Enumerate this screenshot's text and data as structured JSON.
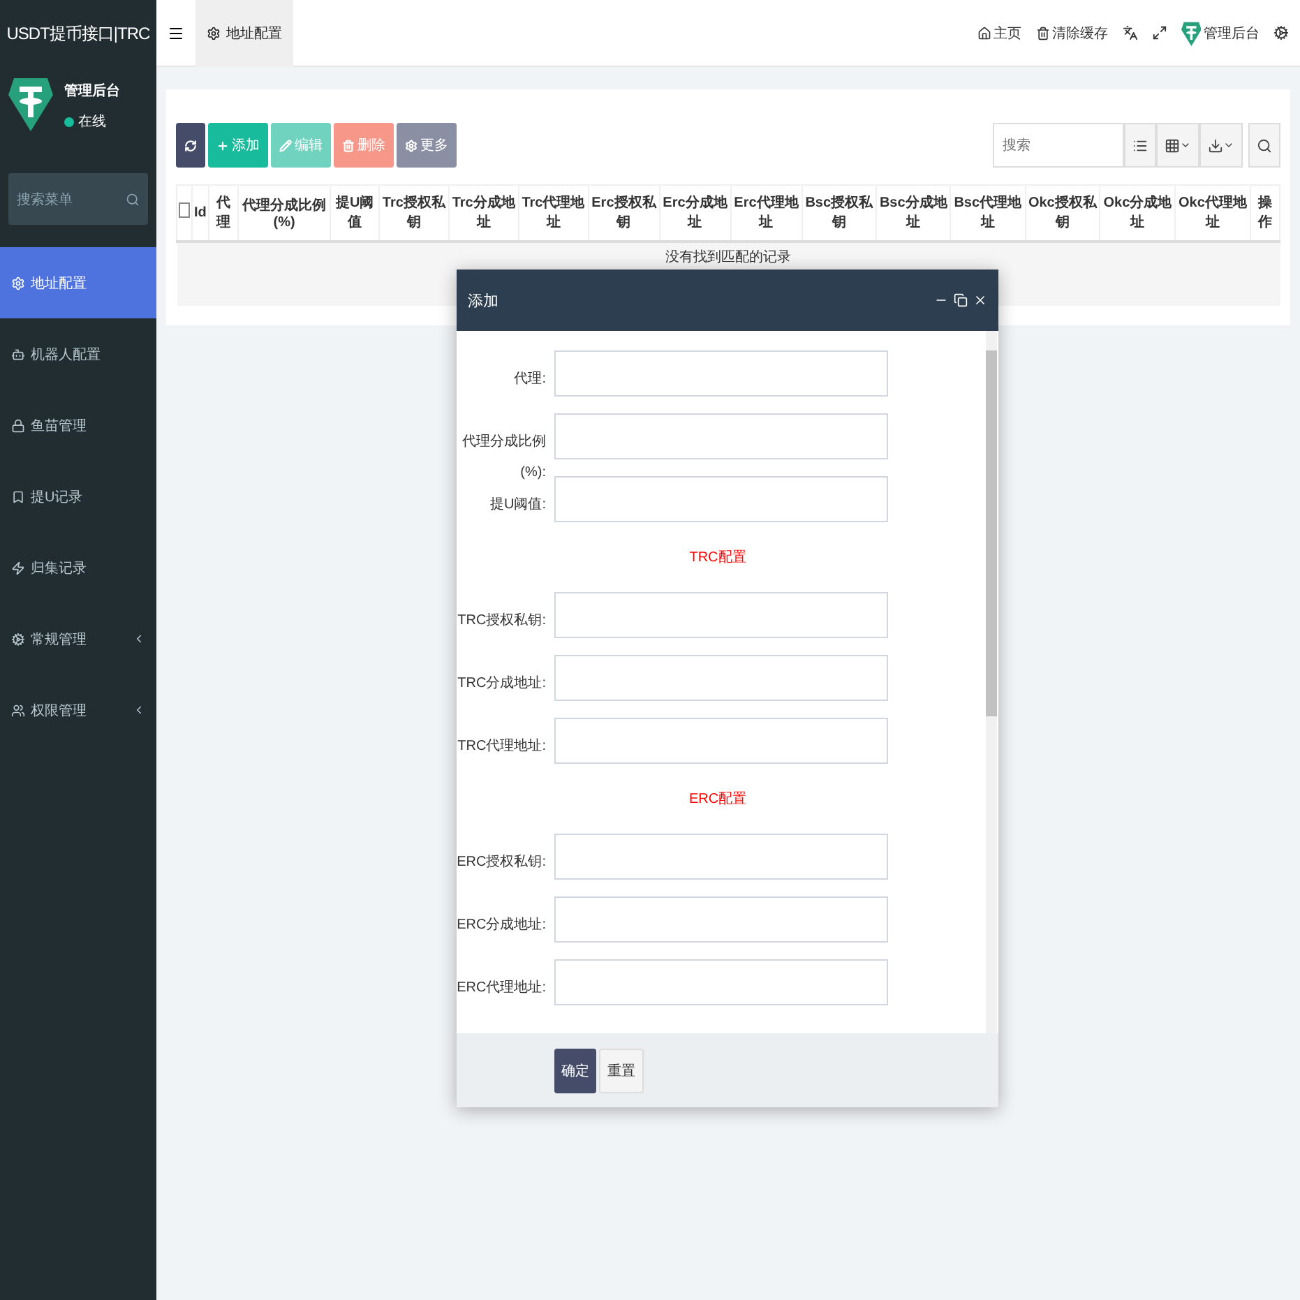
{
  "app_title": "USDT提币接口|TRC",
  "top_bar": {
    "tabs": [
      {
        "label": "地址配置",
        "selected": true
      }
    ],
    "links": [
      {
        "label": "主页"
      },
      {
        "label": "清除缓存"
      }
    ],
    "user": "管理后台"
  },
  "sidebar": {
    "user": {
      "name": "管理后台",
      "status": "在线",
      "online": true
    },
    "search": {
      "placeholder": "搜索菜单"
    },
    "items": [
      {
        "label": "地址配置",
        "selected": true,
        "expandable": false
      },
      {
        "label": "机器人配置",
        "selected": false,
        "expandable": false
      },
      {
        "label": "鱼苗管理",
        "selected": false,
        "expandable": false
      },
      {
        "label": "提U记录",
        "selected": false,
        "expandable": false
      },
      {
        "label": "归集记录",
        "selected": false,
        "expandable": false
      },
      {
        "label": "常规管理",
        "selected": false,
        "expandable": true
      },
      {
        "label": "权限管理",
        "selected": false,
        "expandable": true
      }
    ]
  },
  "toolbar": {
    "buttons": [
      {
        "kind": "refresh"
      },
      {
        "label": "添加",
        "kind": "add"
      },
      {
        "label": "编辑",
        "kind": "edit"
      },
      {
        "label": "删除",
        "kind": "delete"
      },
      {
        "label": "更多",
        "kind": "more"
      }
    ],
    "search": {
      "placeholder": "搜索"
    }
  },
  "table": {
    "select_all": {
      "checked": false
    },
    "columns": [
      "Id",
      "代理",
      "代理分成比例(%)",
      "提U阈值",
      "Trc授权私钥",
      "Trc分成地址",
      "Trc代理地址",
      "Erc授权私钥",
      "Erc分成地址",
      "Erc代理地址",
      "Bsc授权私钥",
      "Bsc分成地址",
      "Bsc代理地址",
      "Okc授权私钥",
      "Okc分成地址",
      "Okc代理地址",
      "操作"
    ],
    "empty_message": "没有找到匹配的记录"
  },
  "dialog": {
    "title": "添加",
    "fields": [
      {
        "kind": "field",
        "label": "代理:"
      },
      {
        "kind": "field",
        "label": "代理分成比例(%):"
      },
      {
        "kind": "field",
        "label": "提U阈值:"
      },
      {
        "kind": "section",
        "label": "TRC配置"
      },
      {
        "kind": "field",
        "label": "TRC授权私钥:"
      },
      {
        "kind": "field",
        "label": "TRC分成地址:"
      },
      {
        "kind": "field",
        "label": "TRC代理地址:"
      },
      {
        "kind": "section",
        "label": "ERC配置"
      },
      {
        "kind": "field",
        "label": "ERC授权私钥:"
      },
      {
        "kind": "field",
        "label": "ERC分成地址:"
      },
      {
        "kind": "field",
        "label": "ERC代理地址:"
      }
    ],
    "buttons": [
      {
        "label": "确定",
        "kind": "primary"
      },
      {
        "label": "重置",
        "kind": "default"
      }
    ]
  }
}
